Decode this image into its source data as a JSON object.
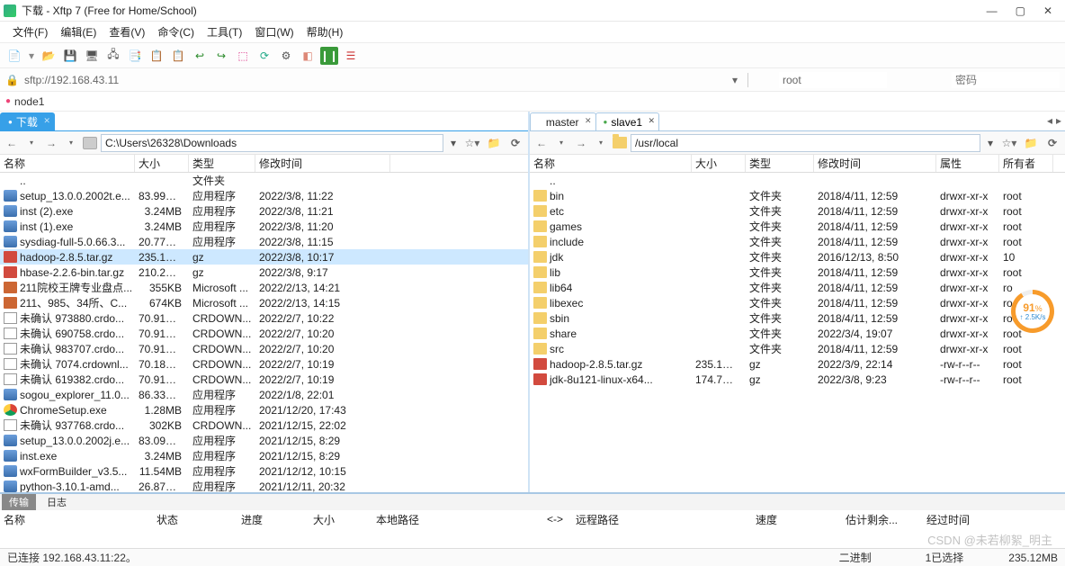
{
  "title": "下载 - Xftp 7 (Free for Home/School)",
  "menus": [
    "文件(F)",
    "编辑(E)",
    "查看(V)",
    "命令(C)",
    "工具(T)",
    "窗口(W)",
    "帮助(H)"
  ],
  "address": "sftp://192.168.43.11",
  "user_value": "root",
  "pass_placeholder": "密码",
  "host_label": "node1",
  "left": {
    "tab": "下载",
    "path": "C:\\Users\\26328\\Downloads",
    "cols": [
      "名称",
      "大小",
      "类型",
      "修改时间"
    ],
    "selected_index": 5,
    "files": [
      {
        "ico": "up",
        "name": "..",
        "size": "",
        "type": "文件夹",
        "mtime": ""
      },
      {
        "ico": "exe",
        "name": "setup_13.0.0.2002t.e...",
        "size": "83.99MB",
        "type": "应用程序",
        "mtime": "2022/3/8, 11:22"
      },
      {
        "ico": "exe",
        "name": "inst (2).exe",
        "size": "3.24MB",
        "type": "应用程序",
        "mtime": "2022/3/8, 11:21"
      },
      {
        "ico": "exe",
        "name": "inst (1).exe",
        "size": "3.24MB",
        "type": "应用程序",
        "mtime": "2022/3/8, 11:20"
      },
      {
        "ico": "exe",
        "name": "sysdiag-full-5.0.66.3...",
        "size": "20.77MB",
        "type": "应用程序",
        "mtime": "2022/3/8, 11:15"
      },
      {
        "ico": "gz",
        "name": "hadoop-2.8.5.tar.gz",
        "size": "235.12MB",
        "type": "gz",
        "mtime": "2022/3/8, 10:17"
      },
      {
        "ico": "gz",
        "name": "hbase-2.2.6-bin.tar.gz",
        "size": "210.26MB",
        "type": "gz",
        "mtime": "2022/3/8, 9:17"
      },
      {
        "ico": "pdf",
        "name": "211院校王牌专业盘点...",
        "size": "355KB",
        "type": "Microsoft ...",
        "mtime": "2022/2/13, 14:21"
      },
      {
        "ico": "pdf",
        "name": "211、985、34所、C...",
        "size": "674KB",
        "type": "Microsoft ...",
        "mtime": "2022/2/13, 14:15"
      },
      {
        "ico": "doc",
        "name": "未确认 973880.crdo...",
        "size": "70.91MB",
        "type": "CRDOWN...",
        "mtime": "2022/2/7, 10:22"
      },
      {
        "ico": "doc",
        "name": "未确认 690758.crdo...",
        "size": "70.91MB",
        "type": "CRDOWN...",
        "mtime": "2022/2/7, 10:20"
      },
      {
        "ico": "doc",
        "name": "未确认 983707.crdo...",
        "size": "70.91MB",
        "type": "CRDOWN...",
        "mtime": "2022/2/7, 10:20"
      },
      {
        "ico": "doc",
        "name": "未确认 7074.crdownl...",
        "size": "70.18MB",
        "type": "CRDOWN...",
        "mtime": "2022/2/7, 10:19"
      },
      {
        "ico": "doc",
        "name": "未确认 619382.crdo...",
        "size": "70.91MB",
        "type": "CRDOWN...",
        "mtime": "2022/2/7, 10:19"
      },
      {
        "ico": "exe",
        "name": "sogou_explorer_11.0...",
        "size": "86.33MB",
        "type": "应用程序",
        "mtime": "2022/1/8, 22:01"
      },
      {
        "ico": "chrome",
        "name": "ChromeSetup.exe",
        "size": "1.28MB",
        "type": "应用程序",
        "mtime": "2021/12/20, 17:43"
      },
      {
        "ico": "doc",
        "name": "未确认 937768.crdo...",
        "size": "302KB",
        "type": "CRDOWN...",
        "mtime": "2021/12/15, 22:02"
      },
      {
        "ico": "exe",
        "name": "setup_13.0.0.2002j.e...",
        "size": "83.09MB",
        "type": "应用程序",
        "mtime": "2021/12/15, 8:29"
      },
      {
        "ico": "exe",
        "name": "inst.exe",
        "size": "3.24MB",
        "type": "应用程序",
        "mtime": "2021/12/15, 8:29"
      },
      {
        "ico": "exe",
        "name": "wxFormBuilder_v3.5...",
        "size": "11.54MB",
        "type": "应用程序",
        "mtime": "2021/12/12, 10:15"
      },
      {
        "ico": "exe",
        "name": "python-3.10.1-amd...",
        "size": "26.87MB",
        "type": "应用程序",
        "mtime": "2021/12/11, 20:32"
      }
    ]
  },
  "right": {
    "tabs": [
      {
        "label": "master",
        "active": true
      },
      {
        "label": "slave1",
        "active": false
      }
    ],
    "path": "/usr/local",
    "cols": [
      "名称",
      "大小",
      "类型",
      "修改时间",
      "属性",
      "所有者"
    ],
    "files": [
      {
        "ico": "up",
        "name": "..",
        "size": "",
        "type": "",
        "mtime": "",
        "perm": "",
        "owner": ""
      },
      {
        "ico": "folder",
        "name": "bin",
        "size": "",
        "type": "文件夹",
        "mtime": "2018/4/11, 12:59",
        "perm": "drwxr-xr-x",
        "owner": "root"
      },
      {
        "ico": "folder",
        "name": "etc",
        "size": "",
        "type": "文件夹",
        "mtime": "2018/4/11, 12:59",
        "perm": "drwxr-xr-x",
        "owner": "root"
      },
      {
        "ico": "folder",
        "name": "games",
        "size": "",
        "type": "文件夹",
        "mtime": "2018/4/11, 12:59",
        "perm": "drwxr-xr-x",
        "owner": "root"
      },
      {
        "ico": "folder",
        "name": "include",
        "size": "",
        "type": "文件夹",
        "mtime": "2018/4/11, 12:59",
        "perm": "drwxr-xr-x",
        "owner": "root"
      },
      {
        "ico": "folder",
        "name": "jdk",
        "size": "",
        "type": "文件夹",
        "mtime": "2016/12/13, 8:50",
        "perm": "drwxr-xr-x",
        "owner": "10"
      },
      {
        "ico": "folder",
        "name": "lib",
        "size": "",
        "type": "文件夹",
        "mtime": "2018/4/11, 12:59",
        "perm": "drwxr-xr-x",
        "owner": "root"
      },
      {
        "ico": "folder",
        "name": "lib64",
        "size": "",
        "type": "文件夹",
        "mtime": "2018/4/11, 12:59",
        "perm": "drwxr-xr-x",
        "owner": "ro"
      },
      {
        "ico": "folder",
        "name": "libexec",
        "size": "",
        "type": "文件夹",
        "mtime": "2018/4/11, 12:59",
        "perm": "drwxr-xr-x",
        "owner": "ro"
      },
      {
        "ico": "folder",
        "name": "sbin",
        "size": "",
        "type": "文件夹",
        "mtime": "2018/4/11, 12:59",
        "perm": "drwxr-xr-x",
        "owner": "root"
      },
      {
        "ico": "folder",
        "name": "share",
        "size": "",
        "type": "文件夹",
        "mtime": "2022/3/4, 19:07",
        "perm": "drwxr-xr-x",
        "owner": "root"
      },
      {
        "ico": "folder",
        "name": "src",
        "size": "",
        "type": "文件夹",
        "mtime": "2018/4/11, 12:59",
        "perm": "drwxr-xr-x",
        "owner": "root"
      },
      {
        "ico": "gz",
        "name": "hadoop-2.8.5.tar.gz",
        "size": "235.12MB",
        "type": "gz",
        "mtime": "2022/3/9, 22:14",
        "perm": "-rw-r--r--",
        "owner": "root"
      },
      {
        "ico": "gz",
        "name": "jdk-8u121-linux-x64...",
        "size": "174.76MB",
        "type": "gz",
        "mtime": "2022/3/8, 9:23",
        "perm": "-rw-r--r--",
        "owner": "root"
      }
    ]
  },
  "progress": {
    "pct": "91",
    "unit": "%",
    "rate": "↑ 2.5K/s"
  },
  "bottom": {
    "tabs": [
      "传输",
      "日志"
    ],
    "cols": [
      "名称",
      "状态",
      "进度",
      "大小",
      "本地路径",
      "<->",
      "远程路径",
      "速度",
      "估计剩余...",
      "经过时间"
    ]
  },
  "status": {
    "conn": "已连接 192.168.43.11:22。",
    "mode": "二进制",
    "sel": "1已选择",
    "size": "235.12MB"
  },
  "watermark": "CSDN @未若柳絮_明主"
}
